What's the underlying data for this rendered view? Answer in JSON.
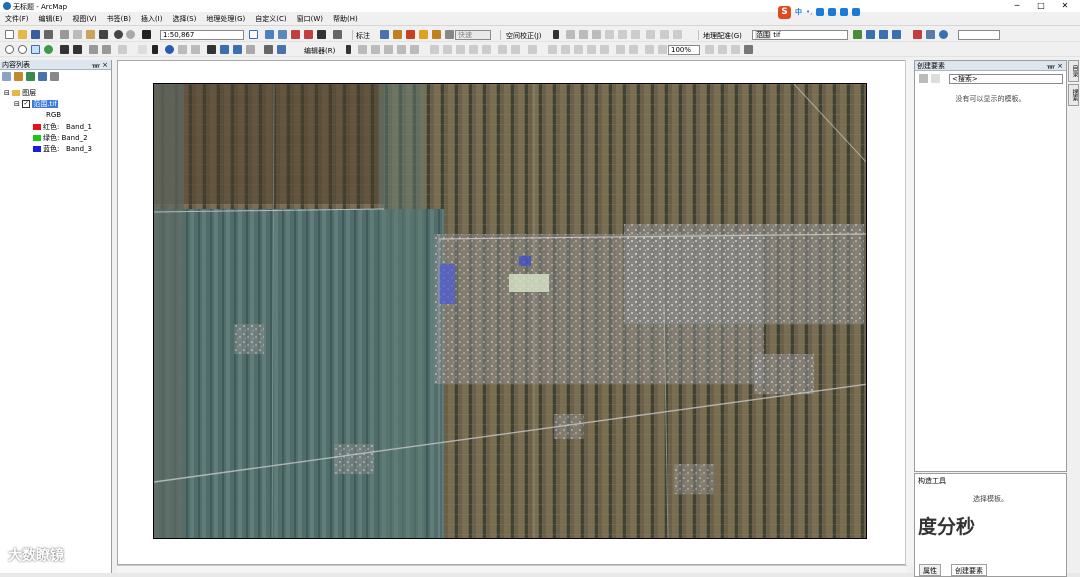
{
  "window": {
    "title": "无标题 - ArcMap",
    "minimize": "─",
    "maximize": "□",
    "close": "✕"
  },
  "menu": [
    "文件(F)",
    "编辑(E)",
    "视图(V)",
    "书签(B)",
    "插入(I)",
    "选择(S)",
    "地理处理(G)",
    "自定义(C)",
    "窗口(W)",
    "帮助(H)"
  ],
  "ime": {
    "logo": "S",
    "mode": "中",
    "punct": "•,"
  },
  "toolbar1": {
    "scale": "1:50,867",
    "annotation_label": "标注",
    "fast_label": "快速",
    "spatial_adjust_label": "空间校正(J)",
    "georef_label": "地理配准(G)",
    "layer_label": "范围",
    "layer_value": "tif",
    "find_value": ""
  },
  "toolbar2": {
    "editor_label": "编辑器(R)",
    "zoom_pct": "100%"
  },
  "toc": {
    "title": "内容列表",
    "pin": "ᚄ ×",
    "layers_group": "图层",
    "raster_name": "范围.tif",
    "rgb_label": "RGB",
    "bands": [
      {
        "label": "红色:",
        "band": "Band_1",
        "color": "#e8101a"
      },
      {
        "label": "绿色:",
        "band": "Band_2",
        "color": "#18c818"
      },
      {
        "label": "蓝色:",
        "band": "Band_3",
        "color": "#1a1ae0"
      }
    ]
  },
  "create_features": {
    "title": "创建要素",
    "pin": "ᚄ ×",
    "search_placeholder": "<搜索>",
    "empty_message": "没有可以显示的模板。"
  },
  "construct_tools": {
    "title": "构造工具",
    "message": "选择模板。"
  },
  "bottom_tabs": [
    "属性",
    "创建要素"
  ],
  "side_tabs": [
    "目录",
    "搜索"
  ],
  "watermarks": {
    "left": "大数瞭镜",
    "right": "度分秒"
  }
}
